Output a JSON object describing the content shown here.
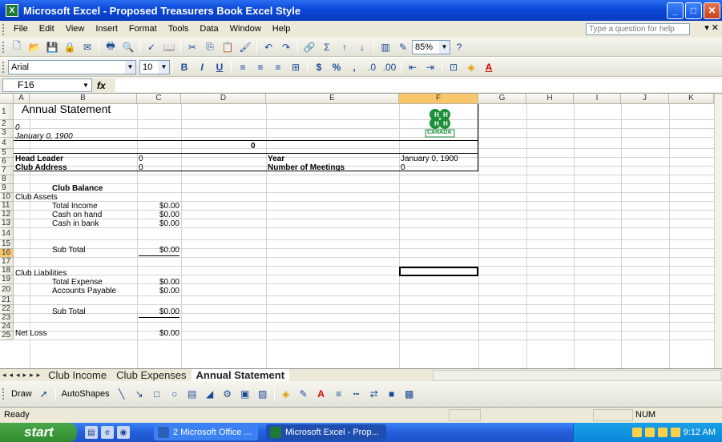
{
  "window": {
    "title": "Microsoft Excel - Proposed Treasurers Book Excel Style",
    "app_icon": "excel-icon"
  },
  "menu": {
    "items": [
      "File",
      "Edit",
      "View",
      "Insert",
      "Format",
      "Tools",
      "Data",
      "Window",
      "Help"
    ],
    "question_box": "Type a question for help"
  },
  "standard_toolbar": {
    "zoom": "85%"
  },
  "formatting_toolbar": {
    "font": "Arial",
    "size": "10",
    "bold": "B",
    "italic": "I",
    "underline": "U",
    "currency": "$",
    "percent": "%",
    "comma": ","
  },
  "formula_bar": {
    "name_box": "F16",
    "fx": "fx",
    "content": ""
  },
  "sheet": {
    "columns": [
      "A",
      "B",
      "C",
      "D",
      "E",
      "F",
      "G",
      "H",
      "I",
      "J",
      "K"
    ],
    "selected_column": "F",
    "selected_row": "16",
    "rows": [
      "1",
      "2",
      "3",
      "4",
      "5",
      "6",
      "7",
      "8",
      "9",
      "10",
      "11",
      "12",
      "13",
      "14",
      "15",
      "16",
      "17",
      "18",
      "19",
      "20",
      "21",
      "22",
      "23",
      "24",
      "25"
    ],
    "cells": {
      "a1": "Annual Statement",
      "a2": "0",
      "a3": "January 0, 1900",
      "d4": "0",
      "b5": "Head Leader",
      "c5": "0",
      "e5": "Year",
      "f5": "January 0, 1900",
      "b6": "Club Address",
      "c6": "0",
      "e6": "Number of Meetings",
      "f6": "0",
      "b8": "Club Balance",
      "a9": "Club Assets",
      "b10": "Total Income",
      "c10": "$0.00",
      "b11": "Cash on hand",
      "c11": "$0.00",
      "b12": "Cash in bank",
      "c12": "$0.00",
      "b14": "Sub Total",
      "c14": "$0.00",
      "a16": "Club Liabilities",
      "b17": "Total Expense",
      "c17": "$0.00",
      "b18": "Accounts Payable",
      "c18": "$0.00",
      "b20": "Sub Total",
      "c20": "$0.00",
      "a22": "Net Loss",
      "c22": "$0.00"
    },
    "logo_text": "CANADA"
  },
  "tabs": [
    "Club Income",
    "Club Expenses",
    "Annual Statement"
  ],
  "active_tab": "Annual Statement",
  "drawing_toolbar": {
    "draw": "Draw",
    "autoshapes": "AutoShapes"
  },
  "status": {
    "ready": "Ready",
    "num": "NUM"
  },
  "taskbar": {
    "start": "start",
    "task1": "2 Microsoft Office ...",
    "task2": "Microsoft Excel - Prop...",
    "clock": "9:12 AM"
  }
}
